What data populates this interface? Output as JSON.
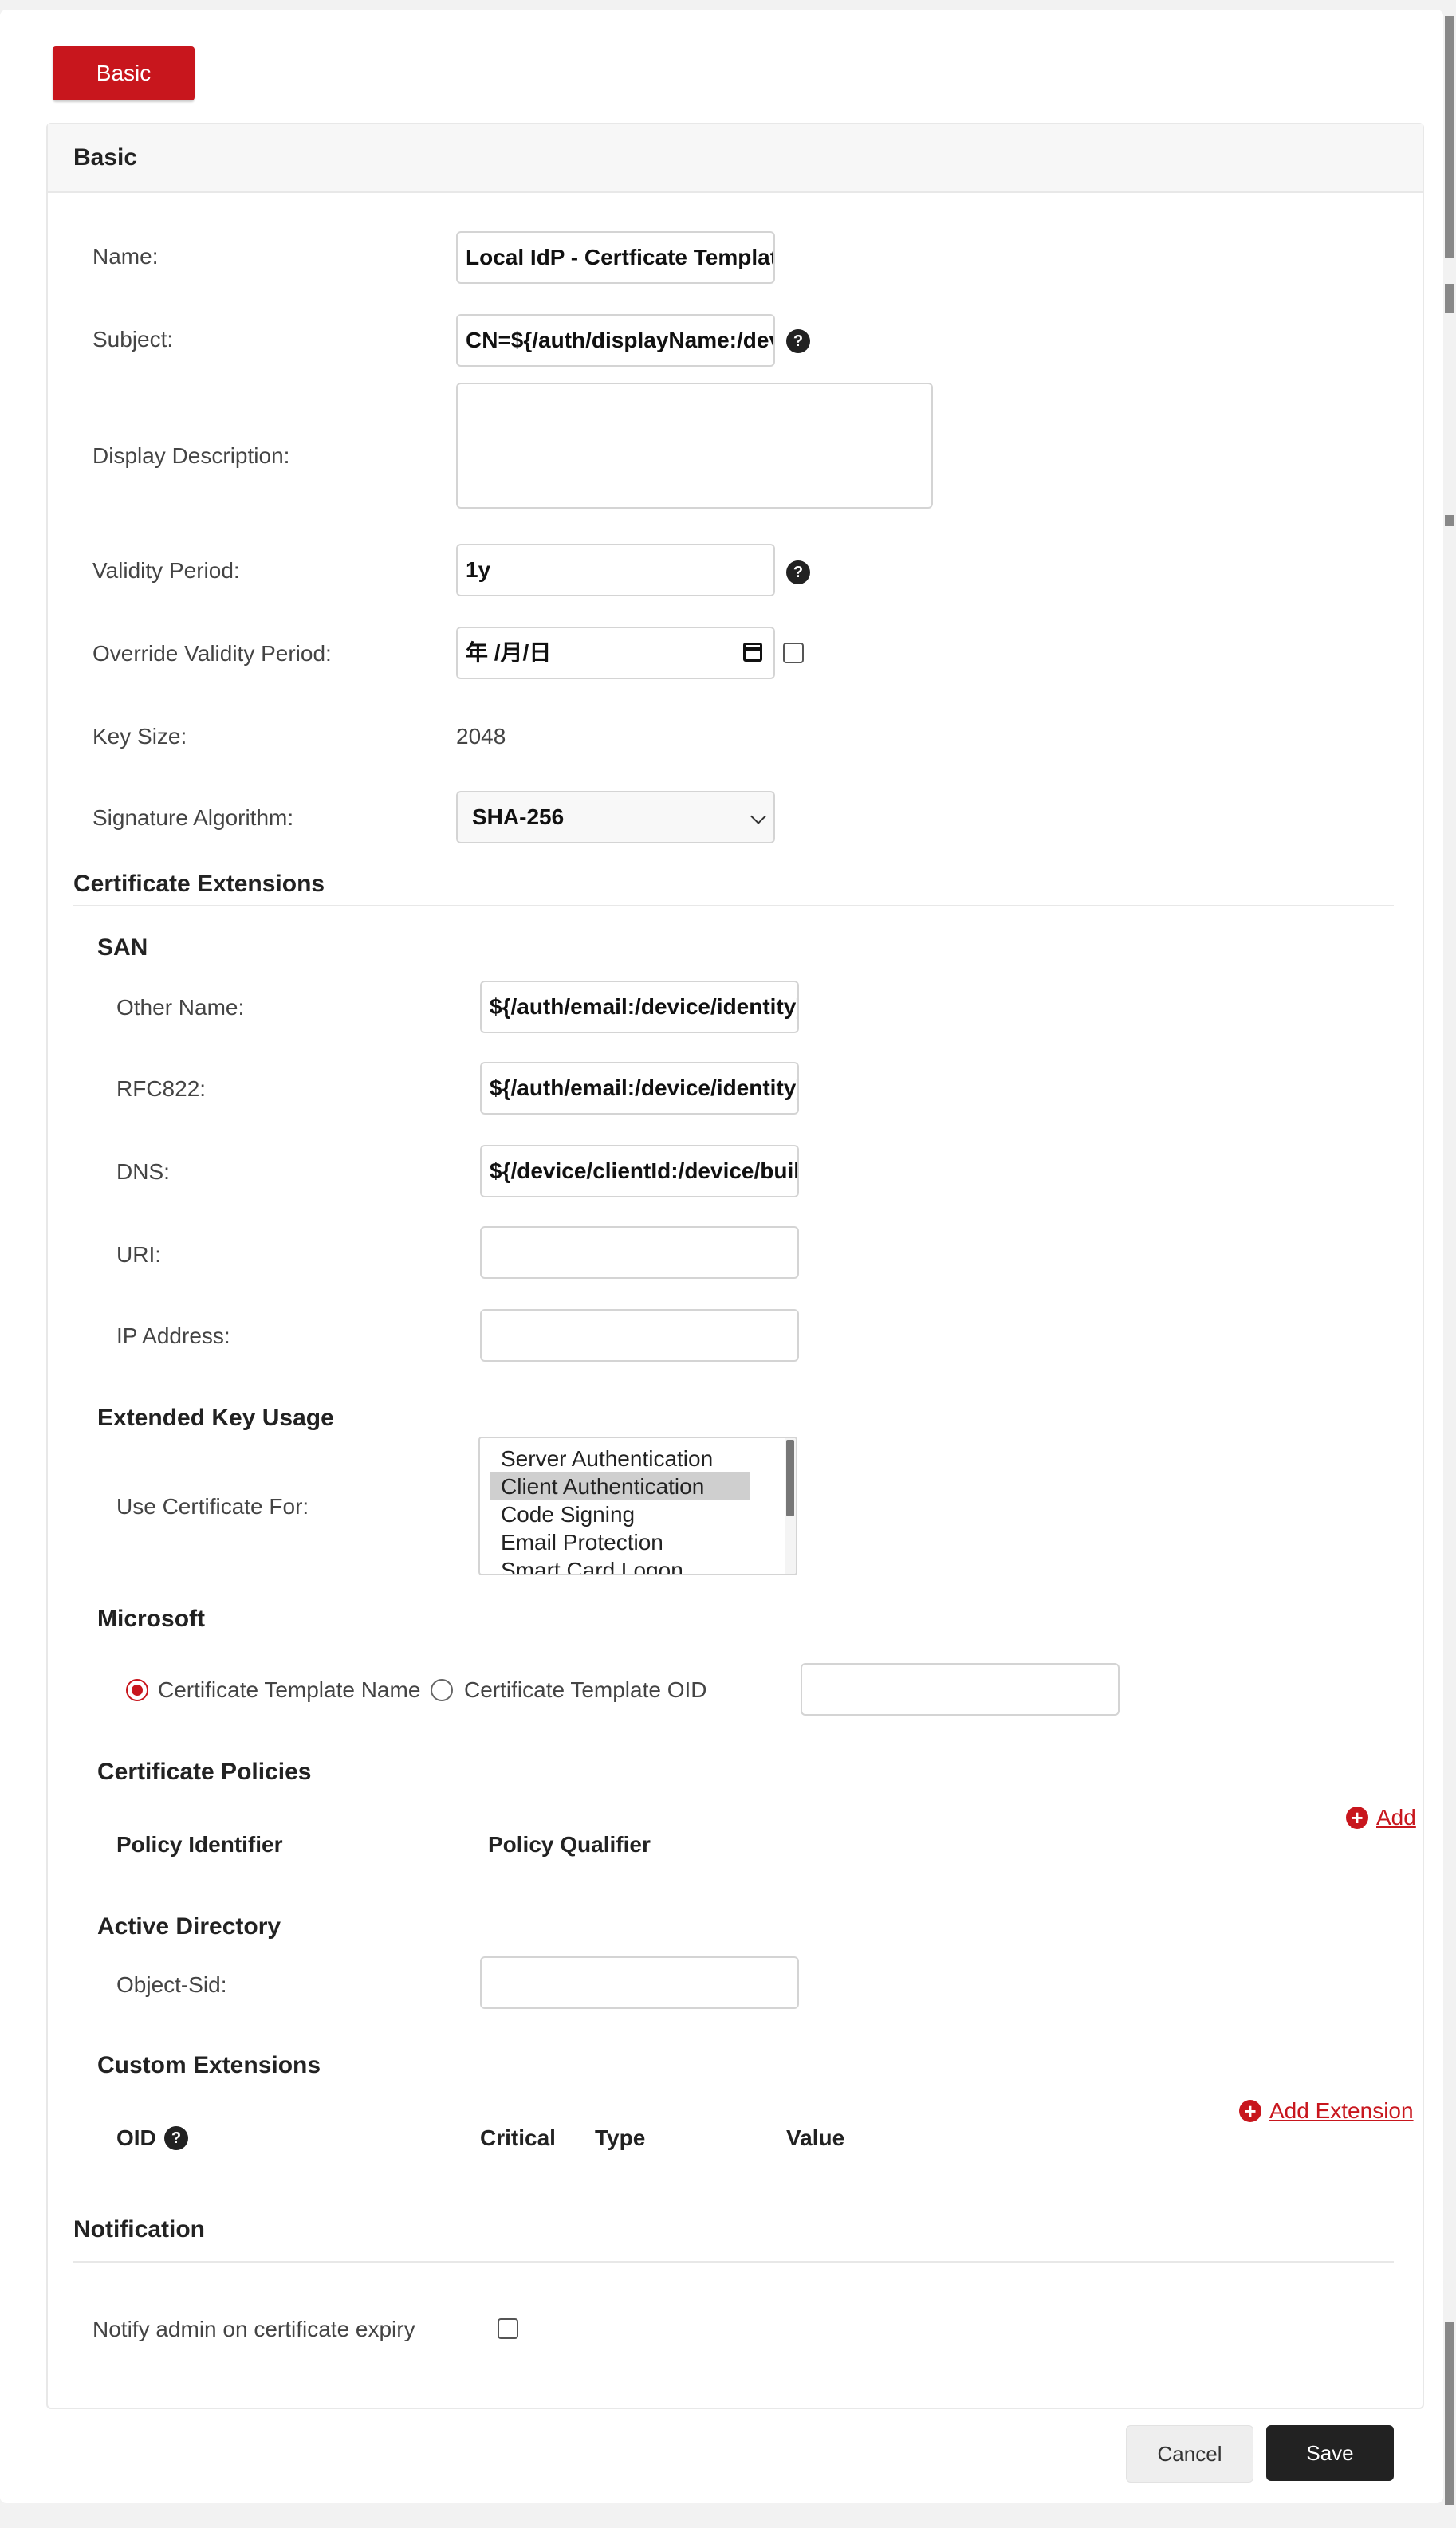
{
  "tab": {
    "label": "Basic"
  },
  "panel": {
    "title": "Basic"
  },
  "form": {
    "name": {
      "label": "Name:",
      "value": "Local IdP - Certficate Template"
    },
    "subject": {
      "label": "Subject:",
      "value": "CN=${/auth/displayName:/device/identity}"
    },
    "description": {
      "label": "Display Description:",
      "value": ""
    },
    "validity": {
      "label": "Validity Period:",
      "value": "1y"
    },
    "override_validity": {
      "label": "Override Validity Period:",
      "value": "年 /月/日"
    },
    "key_size": {
      "label": "Key Size:",
      "value": "2048"
    },
    "signature": {
      "label": "Signature Algorithm:",
      "value": "SHA-256"
    },
    "help_glyph": "?"
  },
  "cert_ext": {
    "title": "Certificate Extensions"
  },
  "san": {
    "title": "SAN",
    "other_name": {
      "label": "Other Name:",
      "value": "${/auth/email:/device/identity}"
    },
    "rfc822": {
      "label": "RFC822:",
      "value": "${/auth/email:/device/identity}"
    },
    "dns": {
      "label": "DNS:",
      "value": "${/device/clientId:/device/buildSerial}"
    },
    "uri": {
      "label": "URI:",
      "value": ""
    },
    "ip": {
      "label": "IP Address:",
      "value": ""
    }
  },
  "eku": {
    "title": "Extended Key Usage",
    "label": "Use Certificate For:",
    "options": [
      "Server Authentication",
      "Client Authentication",
      "Code Signing",
      "Email Protection",
      "Smart Card Logon"
    ],
    "selected_index": 1
  },
  "microsoft": {
    "title": "Microsoft",
    "option_name": "Certificate Template Name",
    "option_oid": "Certificate Template OID",
    "value": ""
  },
  "policies": {
    "title": "Certificate Policies",
    "col_identifier": "Policy Identifier",
    "col_qualifier": "Policy Qualifier",
    "add_label": "Add"
  },
  "active_directory": {
    "title": "Active Directory",
    "object_sid": {
      "label": "Object-Sid:",
      "value": ""
    }
  },
  "custom_ext": {
    "title": "Custom Extensions",
    "col_oid": "OID",
    "col_critical": "Critical",
    "col_type": "Type",
    "col_value": "Value",
    "add_label": "Add Extension"
  },
  "notification": {
    "title": "Notification",
    "notify_label": "Notify admin on certificate expiry"
  },
  "footer": {
    "cancel": "Cancel",
    "save": "Save"
  },
  "colors": {
    "accent": "#c8161d",
    "dark": "#222222"
  },
  "icons": {
    "help": "help-icon",
    "add": "plus-circle-icon",
    "calendar": "calendar-icon",
    "chevron": "chevron-down-icon"
  }
}
